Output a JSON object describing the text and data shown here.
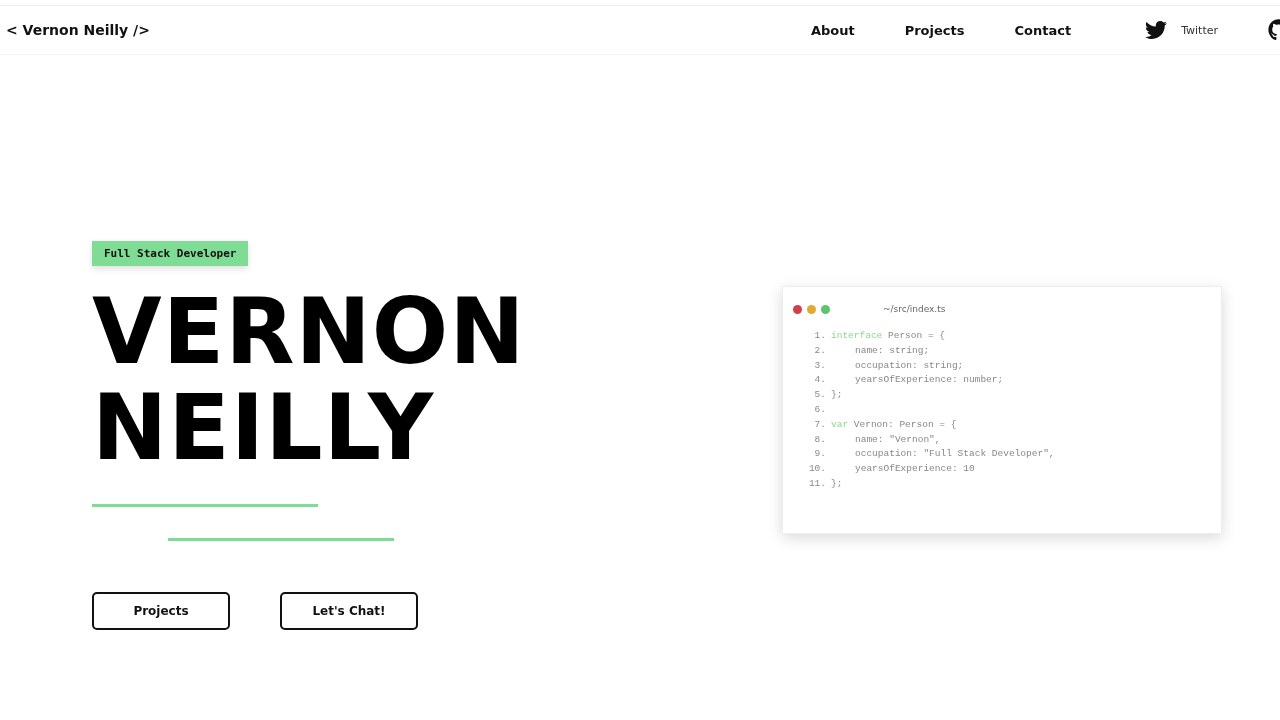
{
  "header": {
    "logo": "< Vernon Neilly />",
    "nav": [
      {
        "label": "About"
      },
      {
        "label": "Projects"
      },
      {
        "label": "Contact"
      }
    ],
    "social": [
      {
        "kind": "twitter",
        "label": "Twitter"
      },
      {
        "kind": "github"
      }
    ]
  },
  "hero": {
    "badge": "Full Stack Developer",
    "name_lines": [
      "VERNON",
      "NEILLY"
    ],
    "buttons": [
      "Projects",
      "Let's Chat!"
    ]
  },
  "code_window": {
    "filename": "~/src/index.ts",
    "lines": [
      {
        "number": "1.",
        "keyword": "interface",
        "text": "Person = {",
        "indent": false
      },
      {
        "number": "2.",
        "text": "name: string;",
        "indent": true
      },
      {
        "number": "3.",
        "text": "occupation: string;",
        "indent": true
      },
      {
        "number": "4.",
        "text": "yearsOfExperience: number;",
        "indent": true
      },
      {
        "number": "5.",
        "text": "};",
        "indent": false
      },
      {
        "number": "6."
      },
      {
        "number": "7.",
        "keyword": "var",
        "text": "Vernon: Person = {",
        "indent": false
      },
      {
        "number": "8.",
        "text": "name: \"Vernon\",",
        "indent": true
      },
      {
        "number": "9.",
        "text": "occupation: \"Full Stack Developer\",",
        "indent": true
      },
      {
        "number": "10.",
        "text": "yearsOfExperience: 10",
        "indent": true
      },
      {
        "number": "11.",
        "text": "};",
        "indent": false
      }
    ]
  }
}
